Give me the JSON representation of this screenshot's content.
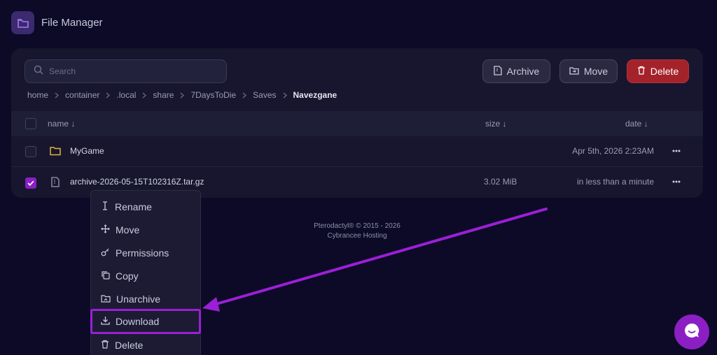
{
  "app": {
    "title": "File Manager"
  },
  "search": {
    "placeholder": "Search"
  },
  "toolbar": {
    "archive_label": "Archive",
    "move_label": "Move",
    "delete_label": "Delete"
  },
  "breadcrumb": [
    "home",
    "container",
    ".local",
    "share",
    "7DaysToDie",
    "Saves"
  ],
  "breadcrumb_current": "Navezgane",
  "table": {
    "col_name": "name ↓",
    "col_size": "size ↓",
    "col_date": "date ↓",
    "rows": [
      {
        "name": "MyGame",
        "size": "",
        "date": "Apr 5th, 2026 2:23AM",
        "checked": false,
        "icon": "folder-icon"
      },
      {
        "name": "archive-2026-05-15T102316Z.tar.gz",
        "size": "3.02 MiB",
        "date": "in less than a minute",
        "checked": true,
        "icon": "file-archive-icon"
      }
    ]
  },
  "context_menu": {
    "items": [
      {
        "label": "Rename",
        "icon": "text-cursor-icon"
      },
      {
        "label": "Move",
        "icon": "move-arrows-icon"
      },
      {
        "label": "Permissions",
        "icon": "key-icon"
      },
      {
        "label": "Copy",
        "icon": "copy-icon"
      },
      {
        "label": "Unarchive",
        "icon": "unarchive-icon"
      },
      {
        "label": "Download",
        "icon": "download-icon",
        "highlighted": true
      },
      {
        "label": "Delete",
        "icon": "trash-icon"
      }
    ]
  },
  "footer": {
    "line1": "Pterodactyl® © 2015 - 2026",
    "line2": "Cybrancee Hosting"
  },
  "colors": {
    "accent": "#8b1fc4",
    "danger": "#a4222a",
    "annotation": "#9b1fd6",
    "folder": "#e0b43a"
  }
}
